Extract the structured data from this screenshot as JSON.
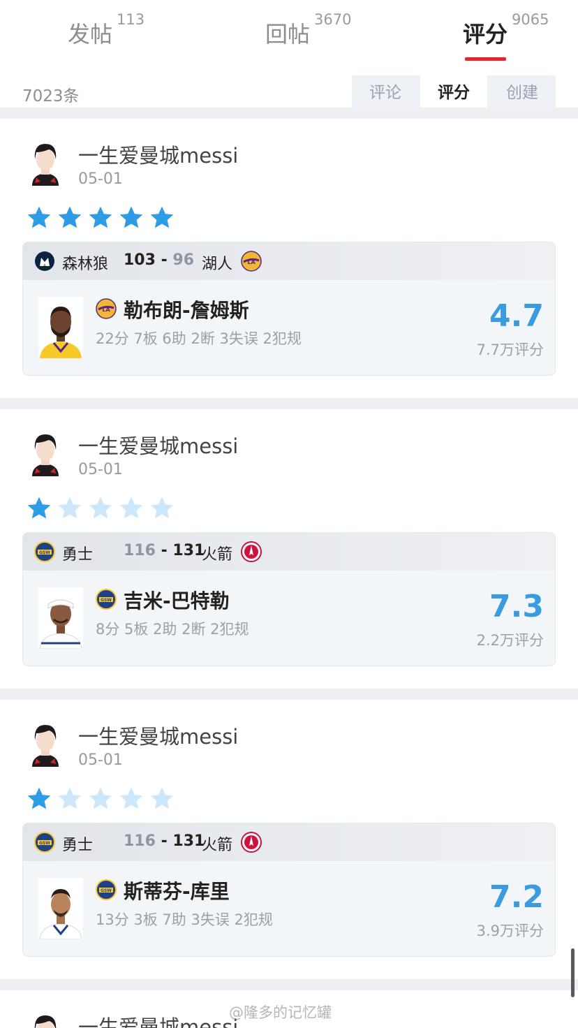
{
  "tabs": [
    {
      "label": "发帖",
      "count": "113"
    },
    {
      "label": "回帖",
      "count": "3670"
    },
    {
      "label": "评分",
      "count": "9065"
    }
  ],
  "total": "7023条",
  "filters": [
    "评论",
    "评分",
    "创建"
  ],
  "colors": {
    "accent": "#e0262e",
    "star": "#2e9be6",
    "star_empty": "#cde7fa",
    "rating": "#3a9be0"
  },
  "cards": [
    {
      "user": "一生爱曼城messi",
      "date": "05-01",
      "stars": 5,
      "game": {
        "home": "森林狼",
        "home_score": "103",
        "away_score": "96",
        "away": "湖人",
        "home_logo": "timberwolves-logo",
        "away_logo": "lakers-logo"
      },
      "player": {
        "name": "勒布朗-詹姆斯",
        "team_logo": "lakers-logo",
        "stats": "22分 7板 6助 2断 3失误 2犯规",
        "rating": "4.7",
        "count": "7.7万评分"
      }
    },
    {
      "user": "一生爱曼城messi",
      "date": "05-01",
      "stars": 1,
      "game": {
        "home": "勇士",
        "home_score": "116",
        "away_score": "131",
        "away": "火箭",
        "home_logo": "warriors-logo",
        "away_logo": "rockets-logo"
      },
      "player": {
        "name": "吉米-巴特勒",
        "team_logo": "warriors-logo",
        "stats": "8分 5板 2助 2断 2犯规",
        "rating": "7.3",
        "count": "2.2万评分"
      }
    },
    {
      "user": "一生爱曼城messi",
      "date": "05-01",
      "stars": 1,
      "game": {
        "home": "勇士",
        "home_score": "116",
        "away_score": "131",
        "away": "火箭",
        "home_logo": "warriors-logo",
        "away_logo": "rockets-logo"
      },
      "player": {
        "name": "斯蒂芬-库里",
        "team_logo": "warriors-logo",
        "stats": "13分 3板 7助 3失误 2犯规",
        "rating": "7.2",
        "count": "3.9万评分"
      }
    },
    {
      "user": "一生爱曼城messi"
    }
  ],
  "watermark": "@隆多的记忆罐"
}
